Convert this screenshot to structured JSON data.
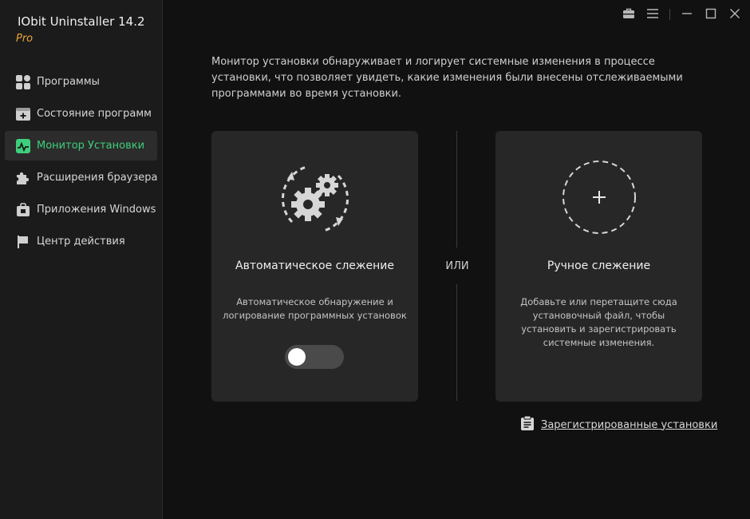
{
  "app": {
    "title": "IObit Uninstaller 14.2",
    "edition": "Pro"
  },
  "sidebar": {
    "items": [
      {
        "label": "Программы",
        "icon": "programs-icon"
      },
      {
        "label": "Состояние программ",
        "icon": "program-status-icon"
      },
      {
        "label": "Монитор Установки",
        "icon": "install-monitor-icon",
        "active": true
      },
      {
        "label": "Расширения браузера",
        "icon": "puzzle-icon"
      },
      {
        "label": "Приложения Windows",
        "icon": "windows-apps-icon"
      },
      {
        "label": "Центр действия",
        "icon": "action-center-icon"
      }
    ]
  },
  "window_controls": [
    "toolbox-icon",
    "menu-icon",
    "minimize-icon",
    "maximize-icon",
    "close-icon"
  ],
  "main": {
    "description": "Монитор установки обнаруживает и логирует системные изменения в процессе установки, что позволяет увидеть, какие изменения были внесены отслеживаемыми программами во время установки.",
    "auto_card": {
      "title": "Автоматическое слежение",
      "description": "Автоматическое обнаружение и логирование программных установок",
      "toggle_on": false
    },
    "or_label": "ИЛИ",
    "manual_card": {
      "title": "Ручное слежение",
      "description": "Добавьте или перетащите сюда установочный файл, чтобы установить и зарегистрировать системные изменения."
    },
    "registered_link": "Зарегистрированные установки"
  },
  "colors": {
    "accent": "#3ecf7c",
    "edition": "#e8a23b",
    "sidebar_bg": "#1b1b1b",
    "main_bg": "#111111",
    "card_bg": "#272727"
  }
}
